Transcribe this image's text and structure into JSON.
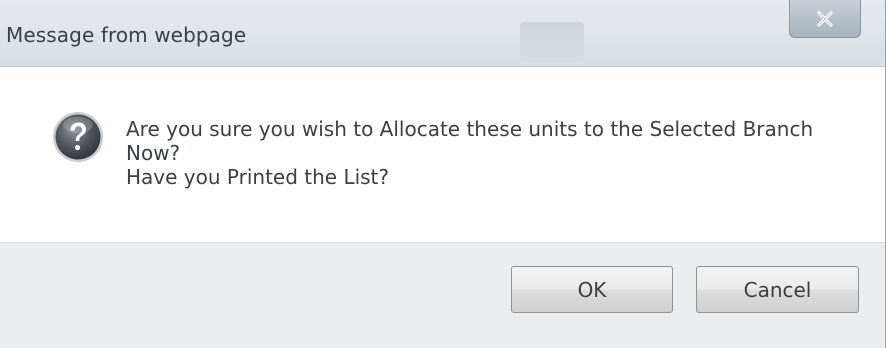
{
  "dialog": {
    "title": "Message from webpage",
    "close_label": "X",
    "message_lines": [
      "Are you sure you wish to Allocate these units to the Selected Branch",
      "Now?",
      "Have you Printed the List?"
    ],
    "icon": "question-icon",
    "buttons": {
      "ok_label": "OK",
      "cancel_label": "Cancel"
    }
  },
  "colors": {
    "title_bar": "#dfe4e8",
    "footer": "#eaecee",
    "question_icon_dark": "#4a4f55",
    "text": "#3b4046"
  }
}
